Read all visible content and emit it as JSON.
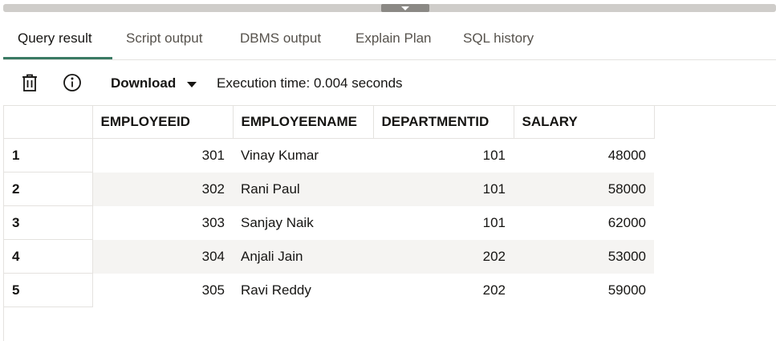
{
  "tabs": [
    {
      "label": "Query result",
      "active": true
    },
    {
      "label": "Script output",
      "active": false
    },
    {
      "label": "DBMS output",
      "active": false
    },
    {
      "label": "Explain Plan",
      "active": false
    },
    {
      "label": "SQL history",
      "active": false
    }
  ],
  "toolbar": {
    "delete_icon": "trash-icon",
    "info_icon": "info-icon",
    "download_label": "Download",
    "execution_time": "Execution time: 0.004 seconds"
  },
  "grid": {
    "columns": [
      "EMPLOYEEID",
      "EMPLOYEENAME",
      "DEPARTMENTID",
      "SALARY"
    ],
    "rows": [
      {
        "n": "1",
        "employeeid": "301",
        "employeename": "Vinay Kumar",
        "departmentid": "101",
        "salary": "48000"
      },
      {
        "n": "2",
        "employeeid": "302",
        "employeename": "Rani Paul",
        "departmentid": "101",
        "salary": "58000"
      },
      {
        "n": "3",
        "employeeid": "303",
        "employeename": "Sanjay Naik",
        "departmentid": "101",
        "salary": "62000"
      },
      {
        "n": "4",
        "employeeid": "304",
        "employeename": "Anjali Jain",
        "departmentid": "202",
        "salary": "53000"
      },
      {
        "n": "5",
        "employeeid": "305",
        "employeename": "Ravi Reddy",
        "departmentid": "202",
        "salary": "59000"
      }
    ]
  },
  "colors": {
    "accent": "#3a7a64",
    "alt_row": "#f5f4f2",
    "border": "#e4e2df"
  }
}
